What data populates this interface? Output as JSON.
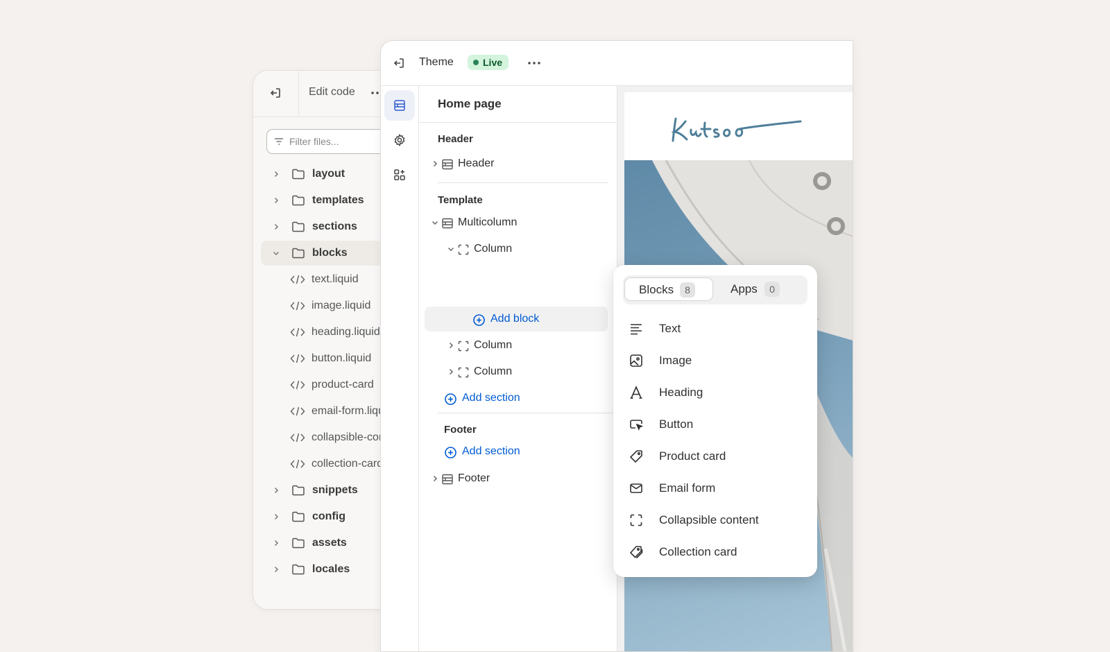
{
  "code_window": {
    "title": "Edit code",
    "filter_placeholder": "Filter files...",
    "folders_top": [
      "layout",
      "templates",
      "sections"
    ],
    "open_folder": "blocks",
    "files": [
      "text.liquid",
      "image.liquid",
      "heading.liquid",
      "button.liquid",
      "product-card",
      "email-form.liquid",
      "collapsible-content",
      "collection-card"
    ],
    "folders_bottom": [
      "snippets",
      "config",
      "assets",
      "locales"
    ]
  },
  "editor": {
    "title": "Theme",
    "status_badge": "Live",
    "panel_title": "Home page",
    "header_group": {
      "label": "Header",
      "items": [
        "Header"
      ]
    },
    "template_group": {
      "label": "Template",
      "section": "Multicolumn",
      "columns": [
        "Column",
        "Column",
        "Column"
      ],
      "add_block": "Add block",
      "add_section": "Add section"
    },
    "footer_group": {
      "label": "Footer",
      "add_section": "Add section",
      "items": [
        "Footer"
      ]
    },
    "preview_logo": "Kutsoo"
  },
  "popover": {
    "tabs": [
      {
        "label": "Blocks",
        "count": "8",
        "selected": true
      },
      {
        "label": "Apps",
        "count": "0",
        "selected": false
      }
    ],
    "items": [
      {
        "label": "Text",
        "icon": "text-align-icon"
      },
      {
        "label": "Image",
        "icon": "image-icon"
      },
      {
        "label": "Heading",
        "icon": "heading-icon"
      },
      {
        "label": "Button",
        "icon": "button-cursor-icon"
      },
      {
        "label": "Product card",
        "icon": "tag-icon"
      },
      {
        "label": "Email form",
        "icon": "email-icon"
      },
      {
        "label": "Collapsible content",
        "icon": "collapsible-icon"
      },
      {
        "label": "Collection card",
        "icon": "tags-icon"
      }
    ]
  },
  "colors": {
    "background": "#f4f1ee",
    "accent_link": "#005bd3",
    "live_badge_bg": "#d4f4dd",
    "live_badge_text": "#0b5a2a",
    "logo": "#4f7f99"
  }
}
